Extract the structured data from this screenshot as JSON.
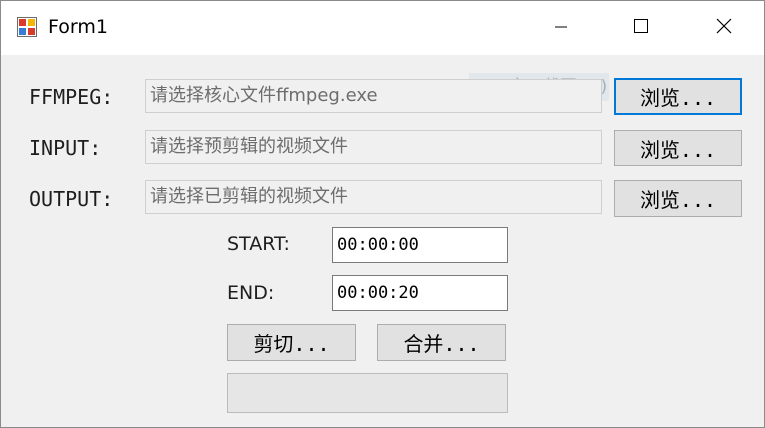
{
  "window": {
    "title": "Form1"
  },
  "form": {
    "ffmpeg": {
      "label": "FFMPEG:",
      "placeholder": "请选择核心文件ffmpeg.exe",
      "browse_label": "浏览..."
    },
    "input": {
      "label": "INPUT:",
      "placeholder": "请选择预剪辑的视频文件",
      "browse_label": "浏览..."
    },
    "output": {
      "label": "OUTPUT:",
      "placeholder": "请选择已剪辑的视频文件",
      "browse_label": "浏览..."
    },
    "start": {
      "label": "START:",
      "value": "00:00:00"
    },
    "end": {
      "label": "END:",
      "value": "00:00:20"
    },
    "cut_label": "剪切...",
    "merge_label": "合并...",
    "progress": 0
  },
  "overlay": {
    "watermark_text": "窗口截图(W)"
  },
  "colors": {
    "focus_border": "#0078d7",
    "button_bg": "#e1e1e1",
    "window_bg": "#f0f0f0",
    "icon_red": "#d83b2b",
    "icon_yellow": "#f2b705",
    "icon_blue": "#3a7bd5"
  },
  "icons": {
    "app": "form-app-icon",
    "minimize": "minimize-icon",
    "maximize": "maximize-icon",
    "close": "close-icon"
  }
}
